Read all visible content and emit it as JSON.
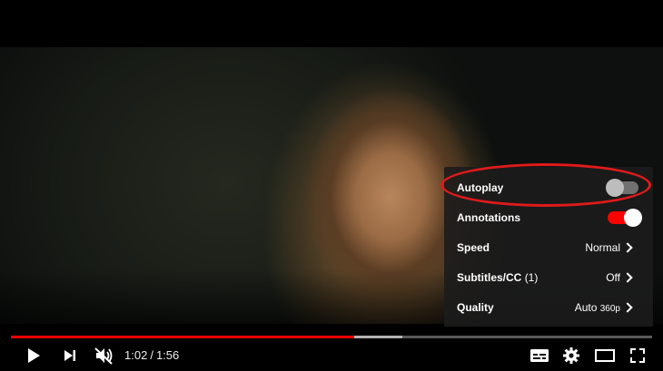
{
  "video": {
    "progress_played_fraction": 0.536,
    "progress_loaded_fraction": 0.61
  },
  "settings": {
    "rows": [
      {
        "label": "Autoplay",
        "type": "toggle",
        "state": "off"
      },
      {
        "label": "Annotations",
        "type": "toggle",
        "state": "on"
      },
      {
        "label": "Speed",
        "value": "Normal",
        "type": "submenu"
      },
      {
        "label": "Subtitles/CC",
        "count": "(1)",
        "value": "Off",
        "type": "submenu"
      },
      {
        "label": "Quality",
        "value": "Auto",
        "value_suffix": "360p",
        "type": "submenu"
      }
    ]
  },
  "controls": {
    "current_time": "1:02",
    "separator": "/",
    "duration": "1:56",
    "icons": [
      "play-icon",
      "next-icon",
      "muted-volume-icon",
      "subtitles-icon",
      "gear-icon",
      "theater-mode-icon",
      "fullscreen-icon"
    ]
  },
  "colors": {
    "accent": "#ff0000",
    "highlight_annotation": "#e01a1a",
    "menu_background": "#1c1c1c"
  }
}
